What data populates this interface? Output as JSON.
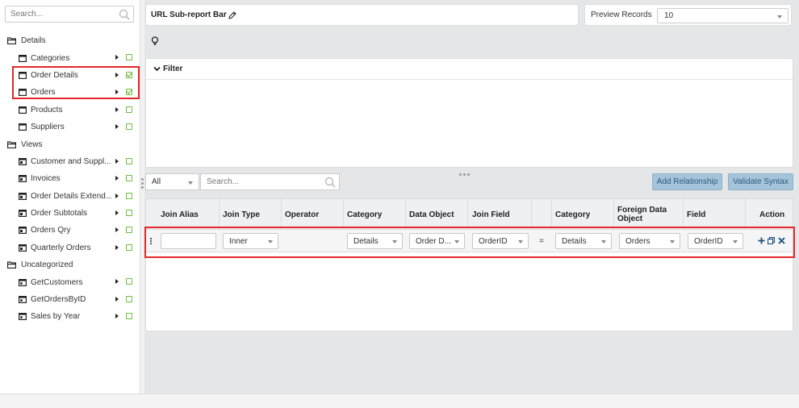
{
  "sidebar": {
    "search_placeholder": "Search...",
    "groups": [
      {
        "label": "Details",
        "items": [
          {
            "label": "Categories",
            "checked": false
          },
          {
            "label": "Order Details",
            "checked": true
          },
          {
            "label": "Orders",
            "checked": true
          },
          {
            "label": "Products",
            "checked": false
          },
          {
            "label": "Suppliers",
            "checked": false
          }
        ]
      },
      {
        "label": "Views",
        "items": [
          {
            "label": "Customer and Suppl...",
            "checked": false
          },
          {
            "label": "Invoices",
            "checked": false
          },
          {
            "label": "Order Details Extend...",
            "checked": false
          },
          {
            "label": "Order Subtotals",
            "checked": false
          },
          {
            "label": "Orders Qry",
            "checked": false
          },
          {
            "label": "Quarterly Orders",
            "checked": false
          }
        ]
      },
      {
        "label": "Uncategorized",
        "items": [
          {
            "label": "GetCustomers",
            "checked": false
          },
          {
            "label": "GetOrdersByID",
            "checked": false
          },
          {
            "label": "Sales by Year",
            "checked": false
          }
        ]
      }
    ]
  },
  "header": {
    "title": "URL Sub-report Bar",
    "preview_label": "Preview Records",
    "preview_value": "10"
  },
  "filter": {
    "label": "Filter"
  },
  "toolbar": {
    "category_filter": "All",
    "search_placeholder": "Search...",
    "add_relationship": "Add Relationship",
    "validate_syntax": "Validate Syntax"
  },
  "grid": {
    "columns": [
      "Join Alias",
      "Join Type",
      "Operator",
      "Category",
      "Data Object",
      "Join Field",
      "Category",
      "Foreign Data Object",
      "Field",
      "Action"
    ],
    "row": {
      "join_alias": "",
      "join_type": "Inner",
      "category": "Details",
      "data_object": "Order D...",
      "join_field": "OrderID",
      "equals": "=",
      "foreign_category": "Details",
      "foreign_object": "Orders",
      "field": "OrderID"
    }
  },
  "colors": {
    "accent_button": "#a5c3d9",
    "highlight": "#e5262c",
    "check": "#4caf1a"
  }
}
